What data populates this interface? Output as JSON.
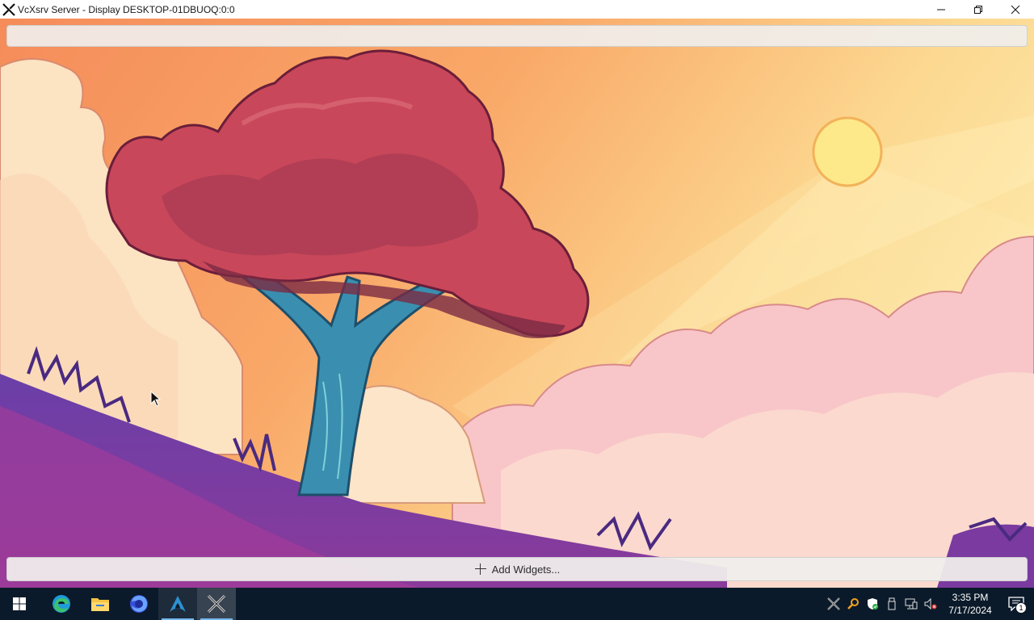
{
  "window": {
    "title": "VcXsrv Server - Display DESKTOP-01DBUOQ:0:0",
    "icon": "x-logo-icon",
    "controls": [
      "minimize-icon",
      "restore-icon",
      "close-icon"
    ]
  },
  "desktop": {
    "wallpaper": "tree-on-hill-sunset",
    "bottom_panel": {
      "add_widgets_label": "Add Widgets...",
      "icon": "plus-icon"
    }
  },
  "taskbar": {
    "apps": [
      {
        "name": "start",
        "icon": "windows-start-icon"
      },
      {
        "name": "edge",
        "icon": "edge-icon"
      },
      {
        "name": "file-explorer",
        "icon": "folder-icon"
      },
      {
        "name": "firefox",
        "icon": "firefox-icon"
      },
      {
        "name": "arch",
        "icon": "arch-linux-icon"
      },
      {
        "name": "vcxsrv",
        "icon": "x-logo-icon"
      }
    ],
    "tray_icons": [
      "x-server-icon",
      "search-key-icon",
      "security-shield-icon",
      "usb-icon",
      "network-icon",
      "volume-muted-icon"
    ],
    "clock": {
      "time": "3:35 PM",
      "date": "7/17/2024"
    },
    "notifications": {
      "count": "1"
    }
  },
  "colors": {
    "taskbar_bg": "#0b1a2a",
    "accent": "#76b9ed"
  }
}
